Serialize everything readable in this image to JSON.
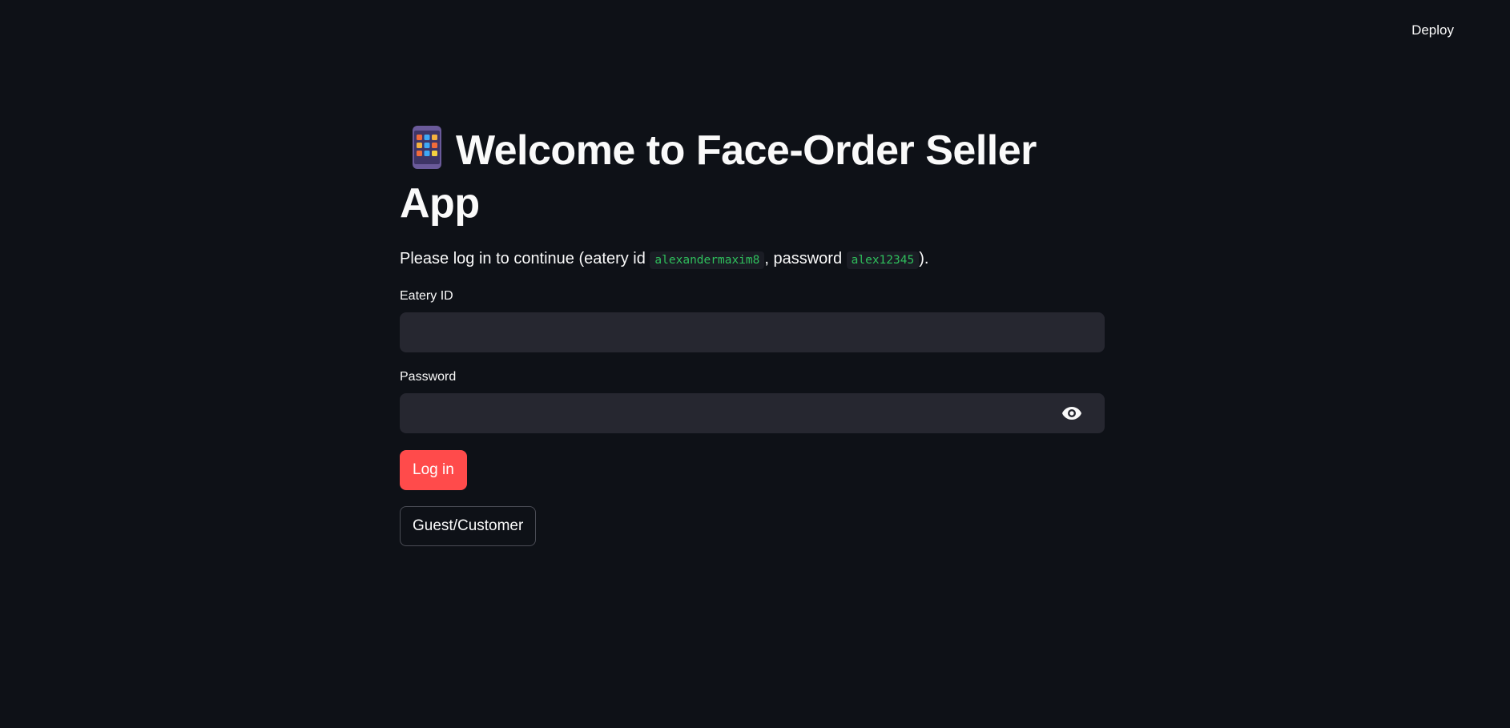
{
  "header": {
    "deploy_label": "Deploy"
  },
  "page": {
    "title_icon": "mobile-phone-icon",
    "title": "Welcome to Face-Order Seller App",
    "intro_prefix": "Please log in to continue (eatery id ",
    "intro_eatery_id": "alexandermaxim8",
    "intro_mid": ", password ",
    "intro_password": "alex12345",
    "intro_suffix": ")."
  },
  "form": {
    "eatery_label": "Eatery ID",
    "eatery_value": "",
    "password_label": "Password",
    "password_value": "",
    "password_toggle_icon": "eye-icon",
    "login_label": "Log in",
    "guest_label": "Guest/Customer"
  },
  "colors": {
    "background": "#0e1117",
    "input_bg": "#262730",
    "primary": "#ff4b4b",
    "code_text": "#2fbf5c"
  }
}
